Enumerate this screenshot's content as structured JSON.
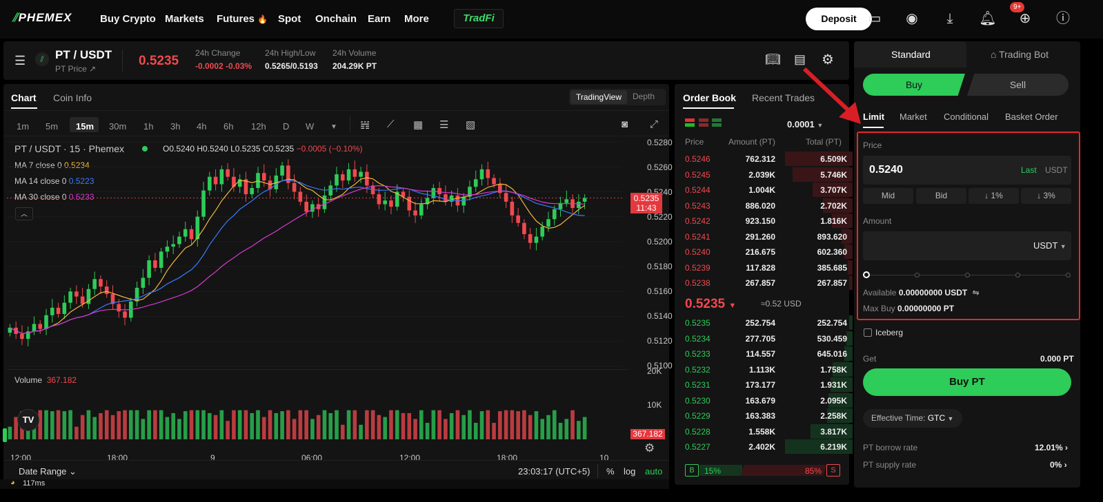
{
  "nav": {
    "logo": "PHEMEX",
    "items": [
      "Buy Crypto",
      "Markets",
      "Futures",
      "Spot",
      "Onchain",
      "Earn",
      "More"
    ],
    "futures_flame": "🔥",
    "tradfi": "TradFi",
    "deposit": "Deposit",
    "notification_badge": "9+"
  },
  "ticker": {
    "pair": "PT / USDT",
    "subtitle": "PT Price ↗",
    "last_price": "0.5235",
    "change_label": "24h Change",
    "change_value": "-0.0002 -0.03%",
    "highlow_label": "24h High/Low",
    "highlow_value": "0.5265/0.5193",
    "volume_label": "24h Volume",
    "volume_value": "204.29K PT"
  },
  "chart_panel": {
    "tabs": [
      "Chart",
      "Coin Info"
    ],
    "views": [
      "TradingView",
      "Depth"
    ],
    "timeframes": [
      "1m",
      "5m",
      "15m",
      "30m",
      "1h",
      "3h",
      "4h",
      "6h",
      "12h",
      "D",
      "W"
    ],
    "active_timeframe": "15m",
    "legend_title": "PT / USDT · 15 · Phemex",
    "ohlc": {
      "o": "O0.5240",
      "h": "H0.5240",
      "l": "L0.5235",
      "c": "C0.5235",
      "chg": "−0.0005 (−0.10%)"
    },
    "ma": [
      {
        "label": "MA 7 close 0",
        "value": "0.5234",
        "color": "#f5b93c"
      },
      {
        "label": "MA 14 close 0",
        "value": "0.5223",
        "color": "#3a7bff"
      },
      {
        "label": "MA 30 close 0",
        "value": "0.5233",
        "color": "#d83ad1"
      }
    ],
    "price_ticks": [
      "0.5280",
      "0.5260",
      "0.5240",
      "0.5220",
      "0.5200",
      "0.5180",
      "0.5160",
      "0.5140",
      "0.5120",
      "0.5100"
    ],
    "current_price_tag": "0.5235",
    "countdown": "11:43",
    "volume_label": "Volume",
    "volume_value": "367.182",
    "volume_ticks": [
      "20K",
      "10K"
    ],
    "volume_tag": "367.182",
    "time_ticks": [
      "12:00",
      "18:00",
      "9",
      "06:00",
      "12:00",
      "18:00",
      "10"
    ],
    "date_range": "Date Range ⌄",
    "clock": "23:03:17 (UTC+5)",
    "scale_options": [
      "%",
      "log",
      "auto"
    ],
    "latency": "117ms"
  },
  "chart_data": {
    "type": "candlestick",
    "title": "PT / USDT · 15 · Phemex",
    "ylim": [
      0.51,
      0.528
    ],
    "x_labels": [
      "12:00",
      "18:00",
      "9",
      "06:00",
      "12:00",
      "18:00",
      "10"
    ],
    "close_series": [
      0.5131,
      0.5126,
      0.5122,
      0.5128,
      0.5134,
      0.513,
      0.5141,
      0.5147,
      0.5142,
      0.5151,
      0.516,
      0.5156,
      0.515,
      0.5162,
      0.517,
      0.5164,
      0.5158,
      0.515,
      0.5144,
      0.5139,
      0.5152,
      0.5163,
      0.5171,
      0.5185,
      0.5179,
      0.5192,
      0.5196,
      0.5198,
      0.5204,
      0.521,
      0.5202,
      0.522,
      0.5241,
      0.5252,
      0.5246,
      0.5258,
      0.5252,
      0.5244,
      0.525,
      0.5238,
      0.5243,
      0.5255,
      0.5249,
      0.5242,
      0.5253,
      0.5261,
      0.5247,
      0.524,
      0.5232,
      0.5224,
      0.523,
      0.5226,
      0.5237,
      0.5245,
      0.5254,
      0.5249,
      0.5258,
      0.5252,
      0.5256,
      0.5245,
      0.5238,
      0.523,
      0.5233,
      0.5228,
      0.524,
      0.5236,
      0.5225,
      0.5221,
      0.523,
      0.5235,
      0.5243,
      0.5238,
      0.5232,
      0.5237,
      0.5229,
      0.5236,
      0.5244,
      0.525,
      0.5258,
      0.5251,
      0.5246,
      0.5239,
      0.5232,
      0.5221,
      0.5215,
      0.5206,
      0.5199,
      0.5204,
      0.5212,
      0.5218,
      0.5226,
      0.5231,
      0.5234,
      0.5227,
      0.5232,
      0.5235
    ],
    "volume_max": 20000,
    "volume_last": 367.182
  },
  "orderbook": {
    "tabs": [
      "Order Book",
      "Recent Trades"
    ],
    "precision": "0.0001",
    "headers": [
      "Price",
      "Amount (PT)",
      "Total (PT)"
    ],
    "asks": [
      {
        "price": "0.5246",
        "amount": "762.312",
        "total": "6.509K",
        "depth": 0.93
      },
      {
        "price": "0.5245",
        "amount": "2.039K",
        "total": "5.746K",
        "depth": 0.83
      },
      {
        "price": "0.5244",
        "amount": "1.004K",
        "total": "3.707K",
        "depth": 0.55
      },
      {
        "price": "0.5243",
        "amount": "886.020",
        "total": "2.702K",
        "depth": 0.41
      },
      {
        "price": "0.5242",
        "amount": "923.150",
        "total": "1.816K",
        "depth": 0.29
      },
      {
        "price": "0.5241",
        "amount": "291.260",
        "total": "893.620",
        "depth": 0.15
      },
      {
        "price": "0.5240",
        "amount": "216.675",
        "total": "602.360",
        "depth": 0.11
      },
      {
        "price": "0.5239",
        "amount": "117.828",
        "total": "385.685",
        "depth": 0.07
      },
      {
        "price": "0.5238",
        "amount": "267.857",
        "total": "267.857",
        "depth": 0.05
      }
    ],
    "mid_price": "0.5235",
    "mid_usd": "≈0.52 USD",
    "bids": [
      {
        "price": "0.5235",
        "amount": "252.754",
        "total": "252.754",
        "depth": 0.05
      },
      {
        "price": "0.5234",
        "amount": "277.705",
        "total": "530.459",
        "depth": 0.09
      },
      {
        "price": "0.5233",
        "amount": "114.557",
        "total": "645.016",
        "depth": 0.11
      },
      {
        "price": "0.5232",
        "amount": "1.113K",
        "total": "1.758K",
        "depth": 0.28
      },
      {
        "price": "0.5231",
        "amount": "173.177",
        "total": "1.931K",
        "depth": 0.3
      },
      {
        "price": "0.5230",
        "amount": "163.679",
        "total": "2.095K",
        "depth": 0.33
      },
      {
        "price": "0.5229",
        "amount": "163.383",
        "total": "2.258K",
        "depth": 0.35
      },
      {
        "price": "0.5228",
        "amount": "1.558K",
        "total": "3.817K",
        "depth": 0.58
      },
      {
        "price": "0.5227",
        "amount": "2.402K",
        "total": "6.219K",
        "depth": 0.93
      }
    ],
    "buy_ratio": "15%",
    "sell_ratio": "85%",
    "b_label": "B",
    "s_label": "S"
  },
  "trade": {
    "tabs": [
      "Standard",
      "Trading Bot"
    ],
    "buy": "Buy",
    "sell": "Sell",
    "order_types": [
      "Limit",
      "Market",
      "Conditional",
      "Basket Order"
    ],
    "price_label": "Price",
    "price_value": "0.5240",
    "last": "Last",
    "price_unit": "USDT",
    "quick": [
      "Mid",
      "Bid",
      "↓ 1%",
      "↓ 3%"
    ],
    "amount_label": "Amount",
    "amount_unit": "USDT",
    "available_label": "Available",
    "available_value": "0.00000000 USDT",
    "maxbuy_label": "Max Buy",
    "maxbuy_value": "0.00000000 PT",
    "iceberg": "Iceberg",
    "get_label": "Get",
    "get_value": "0.000 PT",
    "buy_button": "Buy PT",
    "effective_label": "Effective Time:",
    "effective_value": "GTC",
    "borrow_label": "PT borrow rate",
    "borrow_value": "12.01%",
    "supply_label": "PT supply rate",
    "supply_value": "0%"
  },
  "colors": {
    "up": "#2ecc59",
    "down": "#f0494f",
    "highlight_border": "#e8262b"
  }
}
